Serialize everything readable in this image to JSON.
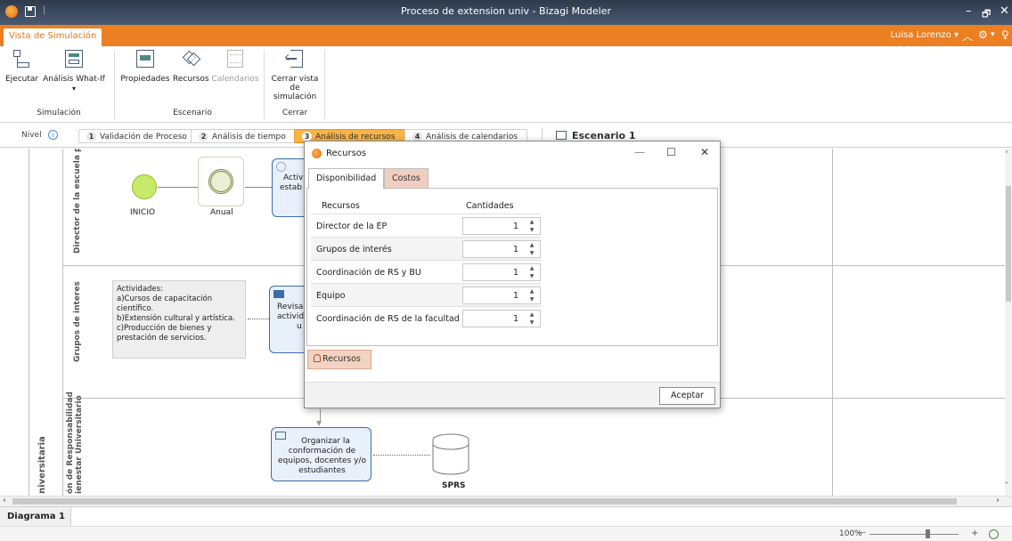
{
  "window": {
    "title": "Proceso de extension univ - Bizagi Modeler",
    "separator": "|",
    "minimize": "–",
    "restore": "🗗",
    "close": "✕"
  },
  "tabstrip": {
    "active_tab": "Vista de Simulación",
    "user": "Luisa Lorenzo  ▾",
    "icons": [
      "chevron-up-icon",
      "gear-icon",
      "lightbulb-icon"
    ]
  },
  "ribbon": {
    "groups": [
      {
        "label": "Simulación",
        "buttons": [
          {
            "label": "Ejecutar"
          },
          {
            "label": "Análisis What-If",
            "dropdown": "▾"
          }
        ]
      },
      {
        "label": "Escenario",
        "buttons": [
          {
            "label": "Propiedades"
          },
          {
            "label": "Recursos"
          },
          {
            "label": "Calendarios",
            "disabled": true
          }
        ]
      },
      {
        "label": "Cerrar",
        "buttons": [
          {
            "label": "Cerrar vista",
            "label2": "de simulación"
          }
        ]
      }
    ]
  },
  "levelbar": {
    "label": "Nivel",
    "info": "i",
    "steps": [
      {
        "num": "1",
        "label": "Validación de Proceso"
      },
      {
        "num": "2",
        "label": "Análisis de tiempo"
      },
      {
        "num": "3",
        "label": "Análisis de recursos",
        "active": true
      },
      {
        "num": "4",
        "label": "Análisis de calendarios"
      }
    ],
    "scenario": "Escenario 1"
  },
  "diagram": {
    "lanes": [
      "Director de la escuela prof",
      "Grupos de interes",
      "ón de Responsabilidad",
      "ienestar Universitario",
      "niversitaria"
    ],
    "start_label": "INICIO",
    "timer_label": "Anual",
    "task1_line1": "Activ",
    "task1_line2": "estab",
    "task2_line1": "Revisar",
    "task2_line2": "activid",
    "task2_line3": "u",
    "task3_lines": [
      "Organizar la",
      "conformación de",
      "equipos, docentes y/o",
      "estudiantes"
    ],
    "datastore_label": "SPRS",
    "note_lines": [
      "Actividades:",
      "a)Cursos de capacitación",
      "científico.",
      "b)Extensión cultural y artística.",
      "c)Producción de bienes y",
      "prestación de servicios."
    ]
  },
  "dialog": {
    "title": "Recursos",
    "minimize": "—",
    "maximize": "☐",
    "close": "✕",
    "tabs": [
      "Disponibilidad",
      "Costos"
    ],
    "columns": [
      "Recursos",
      "Cantidades"
    ],
    "rows": [
      {
        "name": "Director de la EP",
        "qty": "1"
      },
      {
        "name": "Grupos de interés",
        "qty": "1"
      },
      {
        "name": "Coordinación de RS y BU",
        "qty": "1"
      },
      {
        "name": "Equipo",
        "qty": "1"
      },
      {
        "name": "Coordinación de RS de la facultad",
        "qty": "1"
      }
    ],
    "resources_button": "Recursos",
    "accept_button": "Aceptar"
  },
  "bottom": {
    "doc_tab": "Diagrama 1",
    "zoom": "100%",
    "zoom_minus": "—",
    "zoom_plus": "+"
  },
  "colors": {
    "accent_orange": "#ec7f22",
    "active_step": "#f8b545",
    "task_border": "#3b6ea8"
  }
}
